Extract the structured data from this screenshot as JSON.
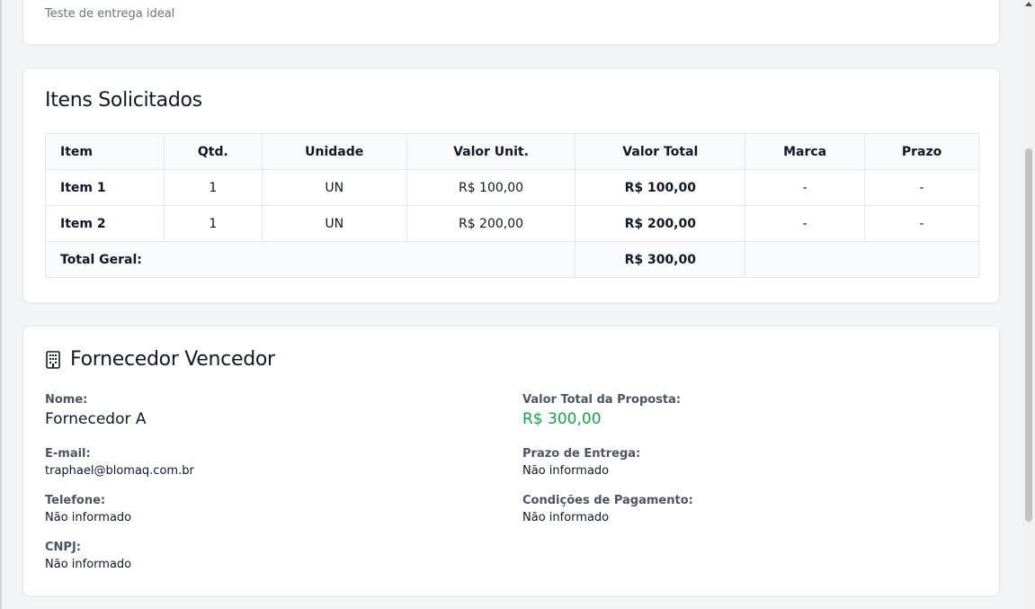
{
  "top_card": {
    "description": "Teste de entrega ideal"
  },
  "items_section": {
    "title": "Itens Solicitados",
    "columns": [
      "Item",
      "Qtd.",
      "Unidade",
      "Valor Unit.",
      "Valor Total",
      "Marca",
      "Prazo"
    ],
    "rows": [
      {
        "item": "Item 1",
        "qtd": "1",
        "unidade": "UN",
        "valor_unit": "R$ 100,00",
        "valor_total": "R$ 100,00",
        "marca": "-",
        "prazo": "-"
      },
      {
        "item": "Item 2",
        "qtd": "1",
        "unidade": "UN",
        "valor_unit": "R$ 200,00",
        "valor_total": "R$ 200,00",
        "marca": "-",
        "prazo": "-"
      }
    ],
    "total_label": "Total Geral:",
    "total_value": "R$ 300,00"
  },
  "supplier_section": {
    "icon": "building-icon",
    "title": "Fornecedor Vencedor",
    "nome_label": "Nome:",
    "nome_value": "Fornecedor A",
    "email_label": "E-mail:",
    "email_value": "traphael@blomaq.com.br",
    "telefone_label": "Telefone:",
    "telefone_value": "Não informado",
    "cnpj_label": "CNPJ:",
    "cnpj_value": "Não informado",
    "valor_total_label": "Valor Total da Proposta:",
    "valor_total_value": "R$ 300,00",
    "prazo_label": "Prazo de Entrega:",
    "prazo_value": "Não informado",
    "condicoes_label": "Condições de Pagamento:",
    "condicoes_value": "Não informado"
  },
  "colors": {
    "accent_green": "#16a34a",
    "card_border": "#e5e7eb",
    "page_background": "#f3f4f6"
  }
}
